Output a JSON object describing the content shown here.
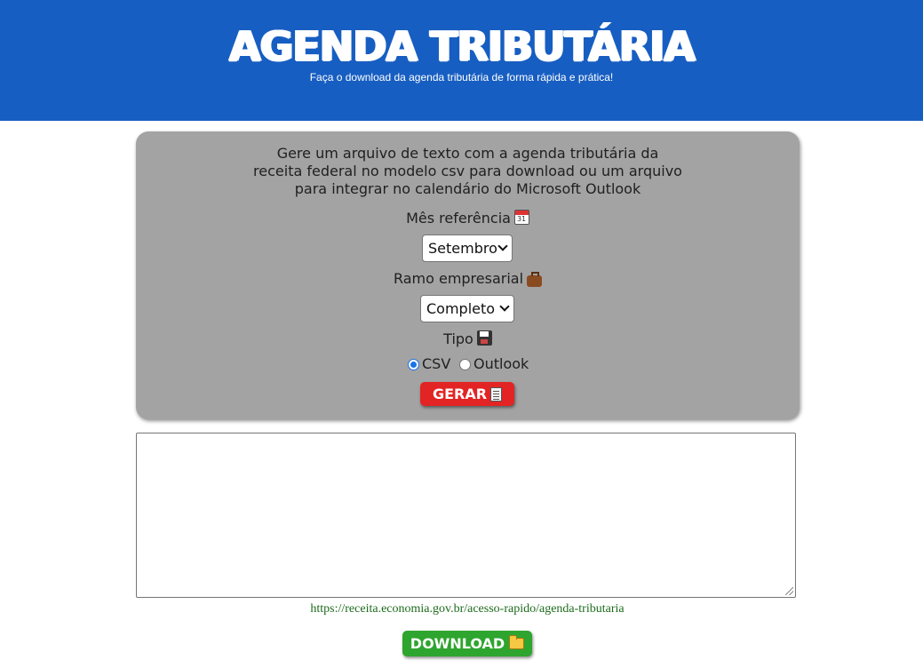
{
  "header": {
    "title": "AGENDA TRIBUTÁRIA",
    "subtitle": "Faça o download da agenda tributária de forma rápida e prática!",
    "background_color": "#175ec2"
  },
  "form": {
    "description": "Gere um arquivo de texto com a agenda tributária da receita federal no modelo csv para download ou um arquivo para integrar no calendário do Microsoft Outlook",
    "month_label": "Mês referência",
    "month_icon": "calendar-icon",
    "month_selected": "Setembro",
    "branch_label": "Ramo empresarial",
    "branch_icon": "briefcase-icon",
    "branch_selected": "Completo",
    "type_label": "Tipo",
    "type_icon": "floppy-disk-icon",
    "type_options": [
      {
        "label": "CSV",
        "checked": true
      },
      {
        "label": "Outlook",
        "checked": false
      }
    ],
    "generate_label": "GERAR",
    "generate_icon": "document-icon",
    "generate_color": "#e32424"
  },
  "output": {
    "textarea_value": "",
    "source_link": "https://receita.economia.gov.br/acesso-rapido/agenda-tributaria",
    "download_label": "DOWNLOAD",
    "download_icon": "folder-icon",
    "download_color": "#2ea52e"
  }
}
